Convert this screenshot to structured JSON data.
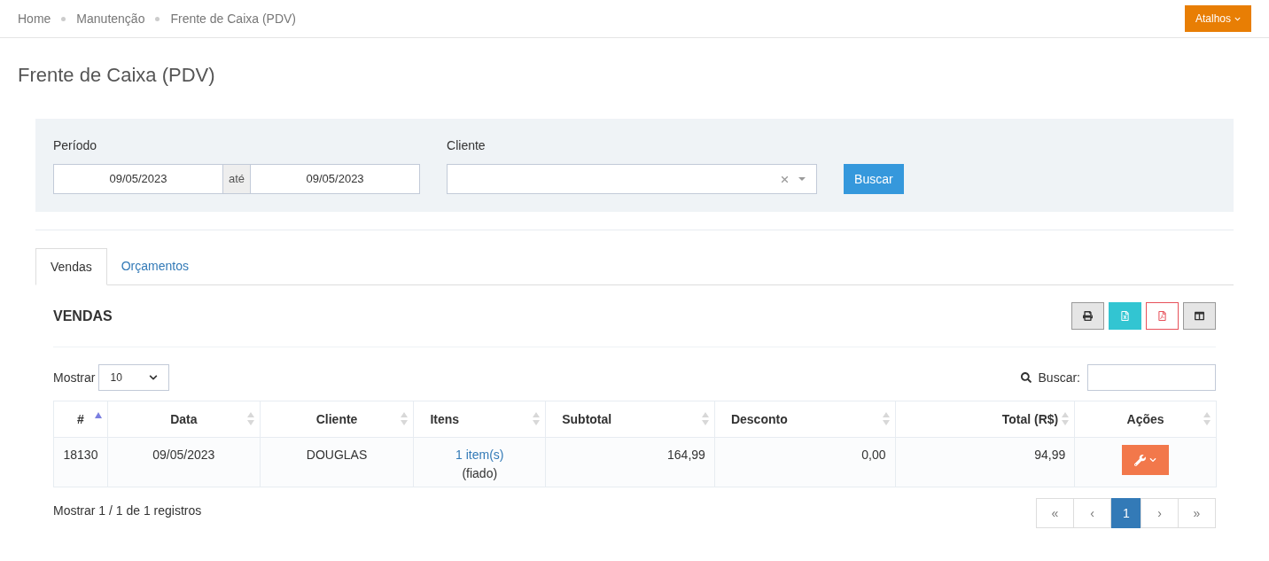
{
  "breadcrumb": [
    "Home",
    "Manutenção",
    "Frente de Caixa (PDV)"
  ],
  "shortcuts_button": "Atalhos",
  "page_title": "Frente de Caixa (PDV)",
  "filters": {
    "period_label": "Período",
    "date_from": "09/05/2023",
    "date_separator": "até",
    "date_to": "09/05/2023",
    "client_label": "Cliente",
    "search_button": "Buscar"
  },
  "tabs": [
    {
      "label": "Vendas",
      "selected": true
    },
    {
      "label": "Orçamentos",
      "selected": false
    }
  ],
  "panel_title": "VENDAS",
  "show_label": "Mostrar",
  "page_size": "10",
  "search_label": "Buscar:",
  "table": {
    "columns": [
      {
        "label": "#",
        "sorted": true
      },
      {
        "label": "Data",
        "sorted": false
      },
      {
        "label": "Cliente",
        "sorted": false
      },
      {
        "label": "Itens",
        "sorted": false
      },
      {
        "label": "Subtotal",
        "sorted": false
      },
      {
        "label": "Desconto",
        "sorted": false
      },
      {
        "label": "Total (R$)",
        "sorted": false
      },
      {
        "label": "Ações",
        "sorted": false
      }
    ],
    "rows": [
      {
        "id": "18130",
        "date": "09/05/2023",
        "client": "DOUGLAS",
        "items_link": "1 item(s)",
        "items_note": "(fiado)",
        "subtotal": "164,99",
        "discount": "0,00",
        "total": "94,99"
      }
    ]
  },
  "footer_info": "Mostrar 1 / 1 de 1 registros",
  "pagination": [
    {
      "label": "«",
      "selected": false
    },
    {
      "label": "‹",
      "selected": false
    },
    {
      "label": "1",
      "selected": true
    },
    {
      "label": "›",
      "selected": false
    },
    {
      "label": "»",
      "selected": false
    }
  ]
}
